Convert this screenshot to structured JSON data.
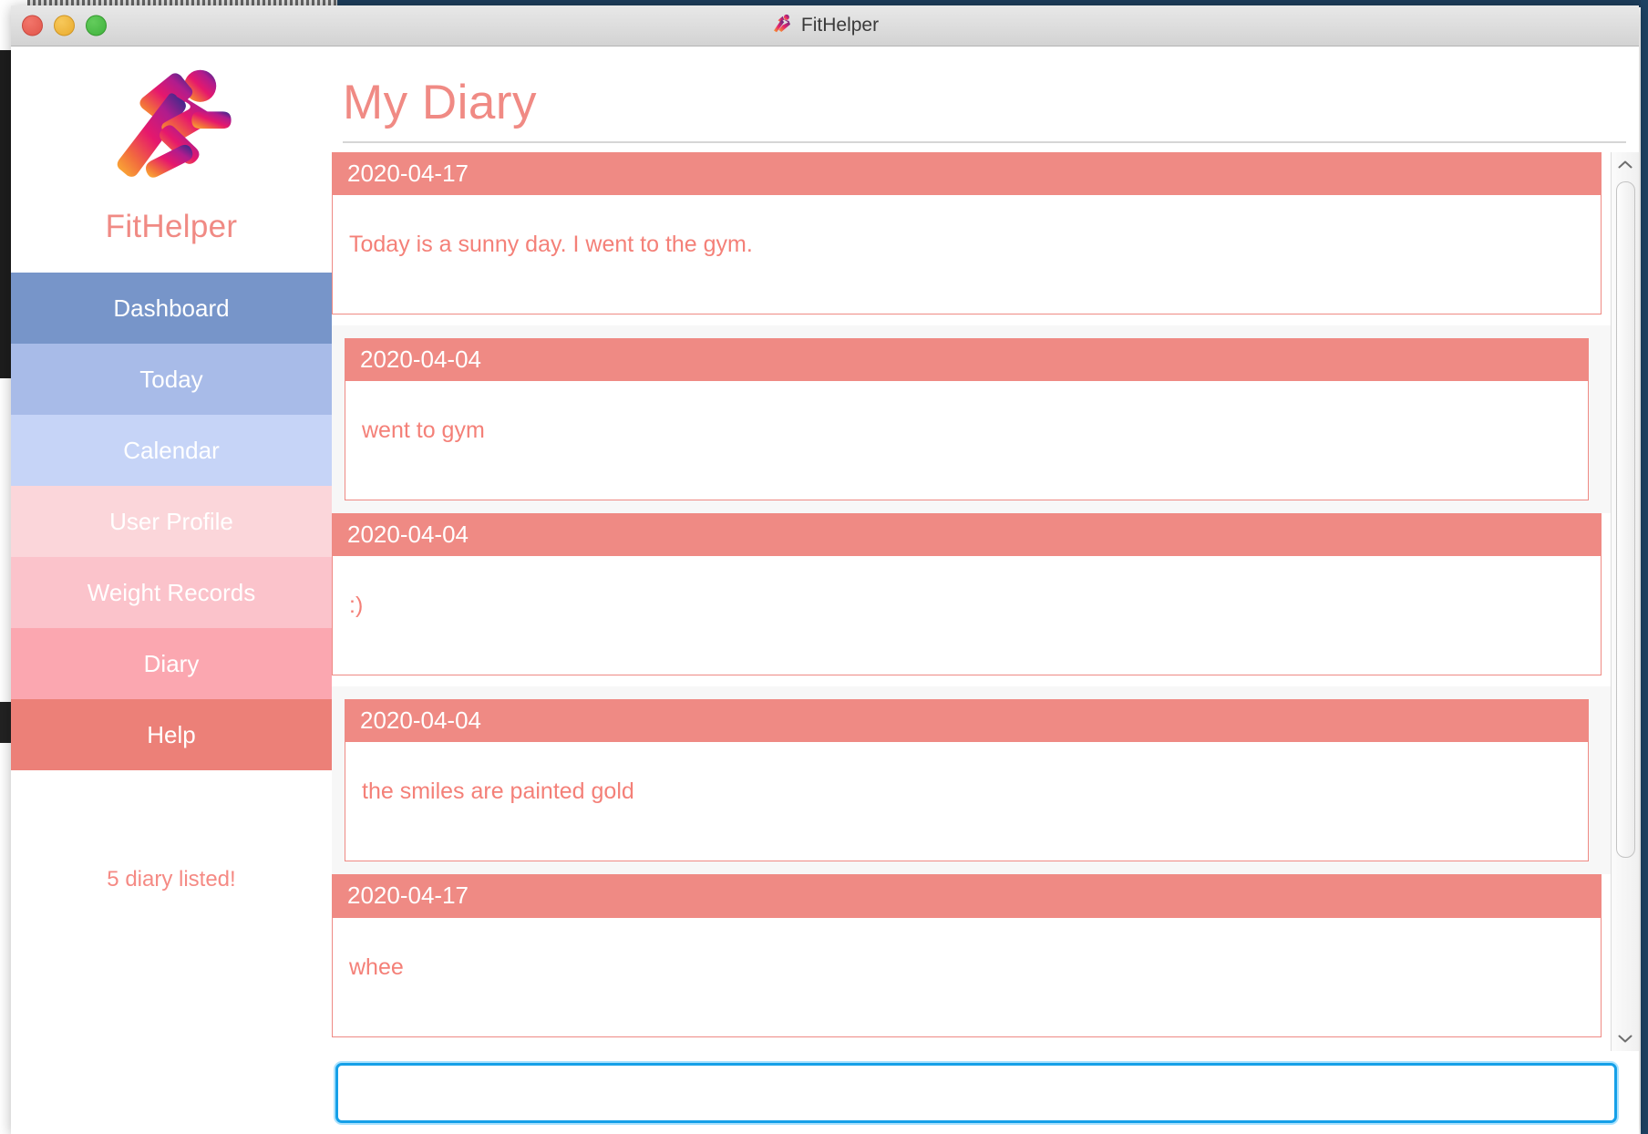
{
  "window": {
    "title": "FitHelper",
    "app_icon": "runner-icon",
    "traffic_lights": {
      "close": "close-button",
      "minimize": "minimize-button",
      "zoom": "zoom-button"
    }
  },
  "sidebar": {
    "logo_icon": "running-figure-logo",
    "brand": "FitHelper",
    "items": [
      {
        "label": "Dashboard",
        "color": "#7795c9"
      },
      {
        "label": "Today",
        "color": "#a8bbe8"
      },
      {
        "label": "Calendar",
        "color": "#c6d4f7"
      },
      {
        "label": "User Profile",
        "color": "#fbd6da"
      },
      {
        "label": "Weight Records",
        "color": "#fbc3cb"
      },
      {
        "label": "Diary",
        "color": "#fba7b0"
      },
      {
        "label": "Help",
        "color": "#ec8078"
      }
    ],
    "status": "5 diary listed!"
  },
  "main": {
    "title": "My Diary",
    "entries": [
      {
        "date": "2020-04-17",
        "text": "Today is a sunny day. I went to the gym."
      },
      {
        "date": "2020-04-04",
        "text": "went to gym"
      },
      {
        "date": "2020-04-04",
        "text": ":)"
      },
      {
        "date": "2020-04-04",
        "text": "the smiles are painted gold"
      },
      {
        "date": "2020-04-17",
        "text": "whee"
      }
    ]
  },
  "scrollbar": {
    "up_arrow": "chevron-up-icon",
    "down_arrow": "chevron-down-icon"
  },
  "input": {
    "value": "",
    "placeholder": ""
  },
  "colors": {
    "accent": "#ef8a84",
    "accent_text": "#f48078",
    "focus_border": "#15a0e8",
    "title_bar": "#dedede"
  }
}
